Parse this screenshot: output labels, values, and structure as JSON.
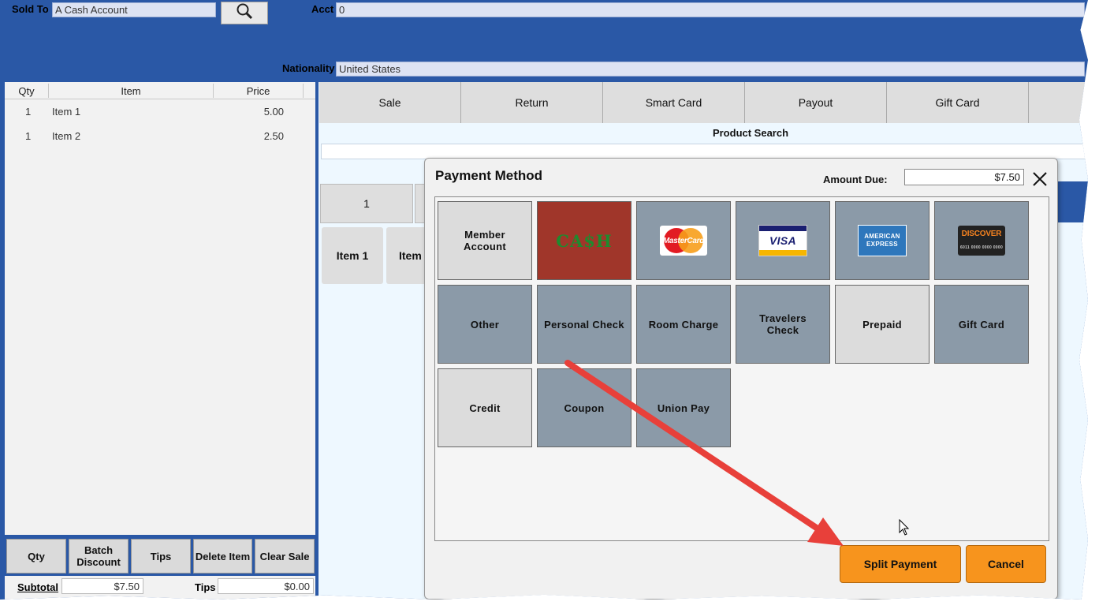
{
  "header": {
    "sold_to_label": "Sold To",
    "sold_to_value": "A Cash Account",
    "acct_label": "Acct",
    "acct_value": "0",
    "nationality_label": "Nationality",
    "nationality_value": "United States",
    "search_icon": "magnifier-icon"
  },
  "sale_list": {
    "columns": [
      "Qty",
      "Item",
      "Price"
    ],
    "rows": [
      {
        "qty": "1",
        "item": "Item 1",
        "price": "5.00"
      },
      {
        "qty": "1",
        "item": "Item 2",
        "price": "2.50"
      }
    ]
  },
  "bottom_buttons": {
    "qty": "Qty",
    "batch_discount": "Batch\nDiscount",
    "tips": "Tips",
    "delete_item": "Delete Item",
    "clear_sale": "Clear Sale"
  },
  "totals": {
    "subtotal_label": "Subtotal",
    "subtotal_value": "$7.50",
    "tips_label": "Tips",
    "tips_value": "$0.00"
  },
  "top_tabs": [
    "Sale",
    "Return",
    "Smart Card",
    "Payout",
    "Gift Card"
  ],
  "product_search": {
    "label": "Product Search",
    "category_tab": "1",
    "items": [
      "Item 1",
      "Item"
    ]
  },
  "dialog": {
    "title": "Payment Method",
    "amount_due_label": "Amount Due:",
    "amount_due_value": "$7.50",
    "close_icon": "close-icon",
    "tiles": {
      "member_account": "Member\nAccount",
      "cash": "CA$H",
      "mastercard": "MasterCard",
      "visa": "VISA",
      "amex_line1": "AMERICAN",
      "amex_line2": "EXPRESS",
      "discover": "DISCOVER",
      "discover_number": "6011 0000 0000 0000",
      "other": "Other",
      "personal_check": "Personal Check",
      "room_charge": "Room Charge",
      "travelers_check": "Travelers\nCheck",
      "prepaid": "Prepaid",
      "gift_card": "Gift Card",
      "credit": "Credit",
      "coupon": "Coupon",
      "union_pay": "Union Pay"
    },
    "split_payment": "Split Payment",
    "cancel": "Cancel"
  },
  "colors": {
    "frame_blue": "#2a58a6",
    "dialog_tile_grey": "#8b9aa8",
    "cash_red": "#a0362a",
    "orange": "#f7941d",
    "annotation_arrow": "#e8403a"
  }
}
